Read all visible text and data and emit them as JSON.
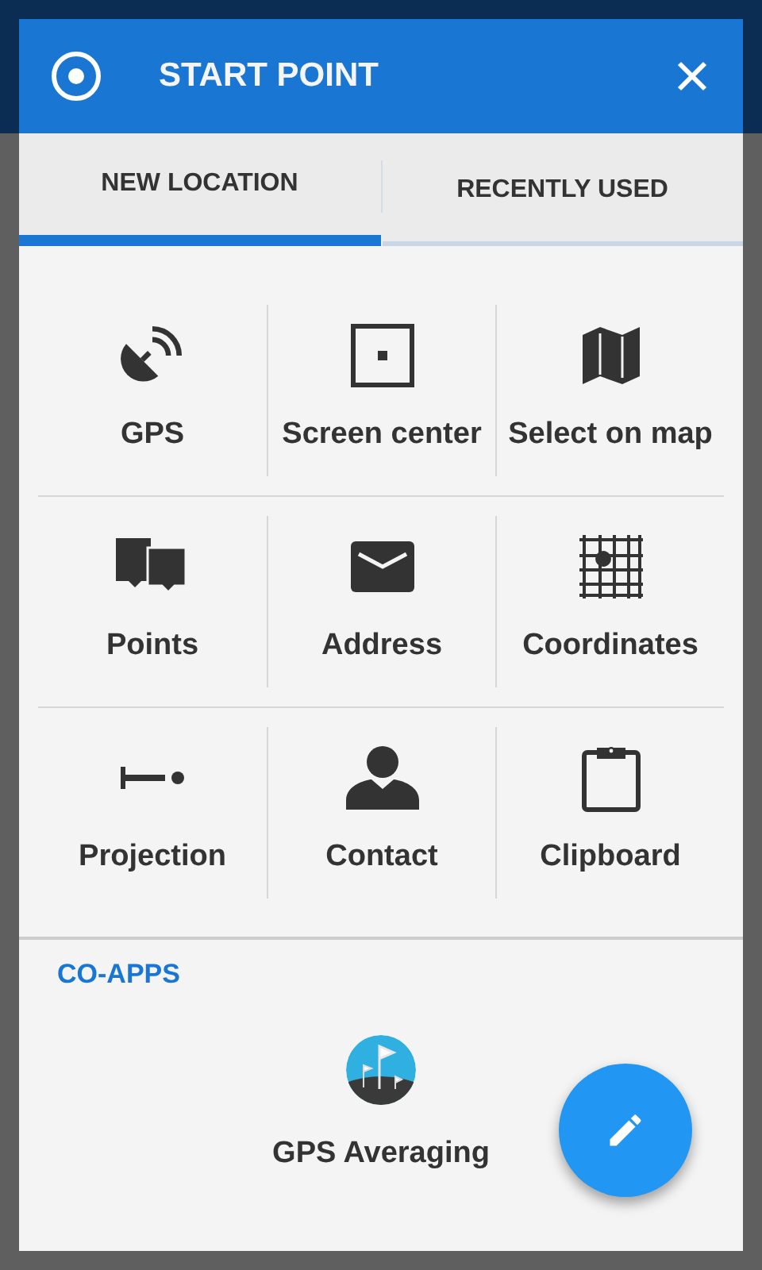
{
  "dialog": {
    "title": "START POINT"
  },
  "tabs": [
    {
      "label": "NEW LOCATION",
      "selected": true
    },
    {
      "label": "RECENTLY USED",
      "selected": false
    }
  ],
  "options": [
    [
      {
        "label": "GPS"
      },
      {
        "label": "Screen center"
      },
      {
        "label": "Select on map"
      }
    ],
    [
      {
        "label": "Points"
      },
      {
        "label": "Address"
      },
      {
        "label": "Coordinates"
      }
    ],
    [
      {
        "label": "Projection"
      },
      {
        "label": "Contact"
      },
      {
        "label": "Clipboard"
      }
    ]
  ],
  "co_apps": {
    "heading": "CO-APPS",
    "apps": [
      {
        "label": "GPS Averaging"
      }
    ]
  }
}
